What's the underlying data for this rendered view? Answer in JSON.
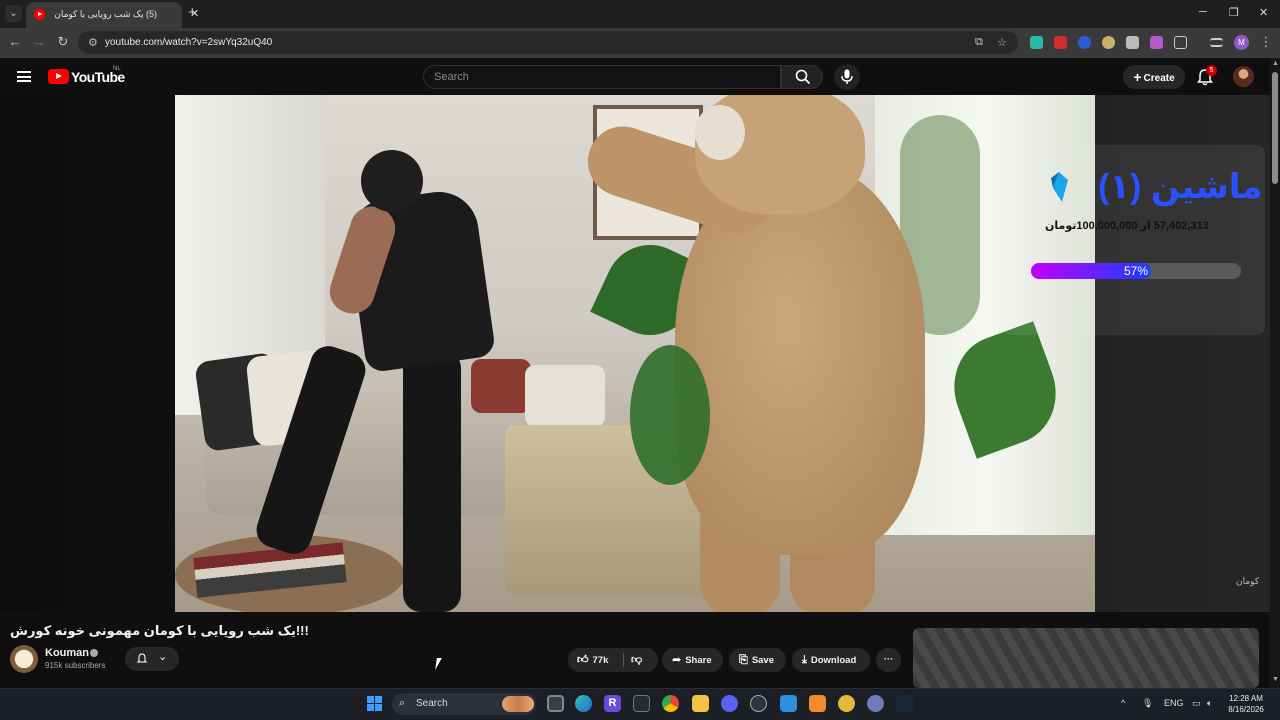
{
  "browser": {
    "tab_title": "(5) یک شب رویایی با کومان ...",
    "tab_audio_icon": "speaker-icon",
    "url": "youtube.com/watch?v=2swYq32uQ40",
    "win_minimize": "─",
    "win_maximize": "❐",
    "win_close": "✕",
    "new_tab": "+",
    "back": "←",
    "forward": "→",
    "reload": "↻"
  },
  "masthead": {
    "logo_text": "YouTube",
    "region": "NL",
    "search_placeholder": "Search",
    "create_label": "Create",
    "notification_count": "5"
  },
  "overlay": {
    "campaign_title": "ماشین (۱)",
    "amount_text": "57,402,313 از 100,000,000تومان",
    "progress_label": "57%",
    "progress_fraction": 0.57,
    "progress_colors": [
      "#c000ff",
      "#1a3cff"
    ],
    "watermark": "کومان"
  },
  "video_info": {
    "title": "!!!یک شب رویایی با کومان مهمونی خونه کورش",
    "channel_name": "Kouman",
    "subscribers": "915k subscribers",
    "likes": "77k",
    "share_label": "Share",
    "save_label": "Save",
    "download_label": "Download",
    "more_label": "···"
  },
  "taskbar": {
    "search_label": "Search",
    "language": "ENG",
    "time": "12:28 AM",
    "date": "8/16/2026"
  },
  "colors": {
    "youtube_red": "#ff0000",
    "page_bg": "#0f0f0f",
    "pill_bg": "#272727",
    "overlay_title": "#2a50ff"
  }
}
